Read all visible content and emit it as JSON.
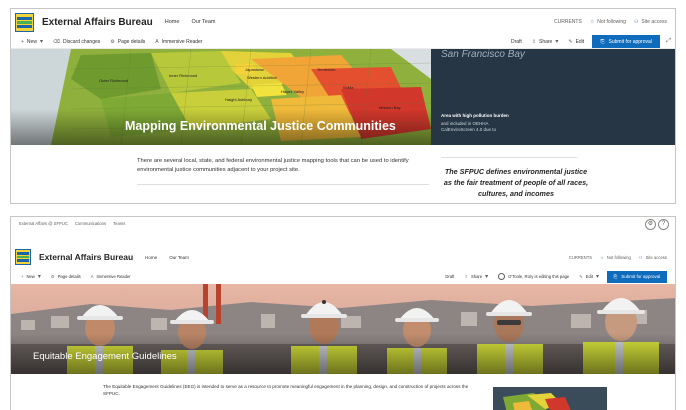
{
  "top": {
    "header": {
      "site_title": "External Affairs Bureau",
      "nav": [
        "Home",
        "Our Team"
      ],
      "current_label": "CURRENTS",
      "not_following": "Not following",
      "site_access": "Site access"
    },
    "commands": {
      "new": "New",
      "discard": "Discard changes",
      "page_details": "Page details",
      "immersive_reader": "Immersive Reader",
      "draft": "Draft",
      "share": "Share",
      "edit": "Edit",
      "submit": "Submit for approval"
    },
    "hero_title": "Mapping Environmental Justice Communities",
    "map_labels": [
      "Japantown",
      "Western Addition",
      "Tenderloin",
      "Outer Richmond",
      "Inner Richmond",
      "Hayes Valley",
      "Haight Ashbury",
      "SoMa",
      "Mission Bay"
    ],
    "bay_label": "San Francisco Bay",
    "side_panel": {
      "heading": "Area with high pollution burden",
      "text": "and included in OEHHA CalEnviroScreen 4.0 due to"
    },
    "body": "There are several local, state, and federal environmental justice mapping tools that can be used to identify environmental justice communities adjacent to your project site.",
    "quote": "The SFPUC defines environmental justice as the fair treatment of people of all races, cultures, and incomes"
  },
  "bottom": {
    "breadcrumb": [
      "External Affairs @ SFPUC",
      "Communications",
      "Teams"
    ],
    "header": {
      "site_title": "External Affairs Bureau",
      "nav": [
        "Home",
        "Our Team"
      ],
      "current_label": "CURRENTS",
      "not_following": "Not following",
      "site_access": "Site access"
    },
    "commands": {
      "new": "New",
      "page_details": "Page details",
      "immersive_reader": "Immersive Reader",
      "draft": "Draft",
      "share": "Share",
      "editing_notice": "O'Toole, Rory is editing this page",
      "edit": "Edit",
      "submit": "Submit for approval"
    },
    "hero_title": "Equitable Engagement Guidelines",
    "body": "The Equitable Engagement Guidelines (EEG) is intended to serve as a resource to promote meaningful engagement in the planning, design, and construction of projects across the SFPUC."
  },
  "colors": {
    "brand_blue": "#0f6cbd",
    "logo_yellow": "#f3d33b",
    "vest_yellow": "#d7e33a"
  }
}
